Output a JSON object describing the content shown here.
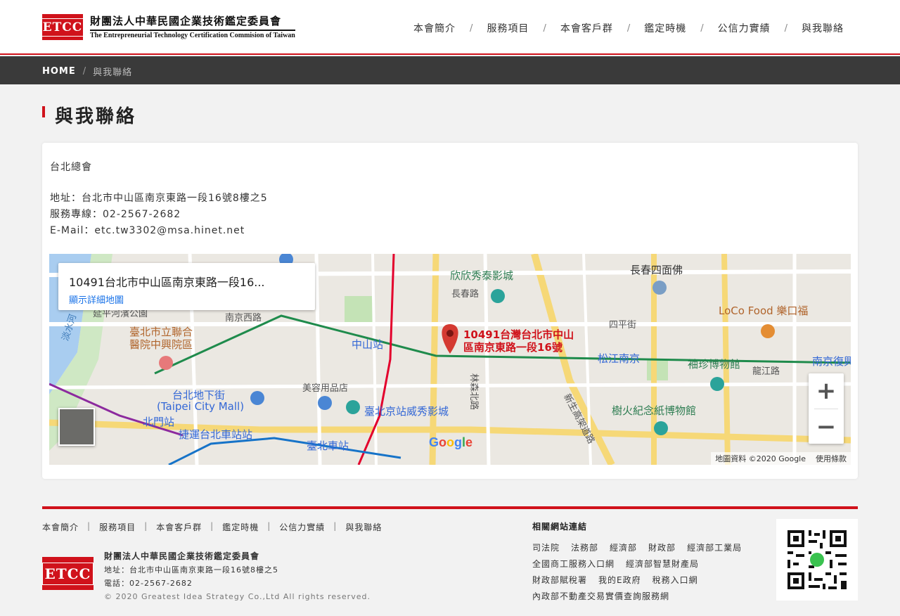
{
  "header": {
    "logo_badge": "ETCC",
    "logo_zh": "財團法人中華民國企業技術鑑定委員會",
    "logo_en": "The Entrepreneurial Technology Certification Commision of Taiwan",
    "nav": [
      "本會簡介",
      "服務項目",
      "本會客戶群",
      "鑑定時機",
      "公信力實績",
      "與我聯絡"
    ],
    "nav_sep": "/"
  },
  "breadcrumb": {
    "home": "HOME",
    "sep": "/",
    "current": "與我聯絡"
  },
  "page_title": "與我聯絡",
  "contact": {
    "office": "台北總會",
    "address": "地址：台北市中山區南京東路一段16號8樓之5",
    "phone": "服務專線：02-2567-2682",
    "email": "E-Mail：etc.tw3302@msa.hinet.net"
  },
  "map": {
    "info_address": "10491台北市中山區南京東路一段16...",
    "info_link": "顯示詳細地圖",
    "pin_label_1": "10491台灣台北市中山",
    "pin_label_2": "區南京東路一段16號",
    "zoom_in": "+",
    "zoom_out": "−",
    "attribution": "地圖資料 ©2020 Google",
    "terms": "使用條款",
    "labels": {
      "cinema": "欣欣秀泰影城",
      "changchun_rd": "長春路",
      "changchun_plaza": "長春四面佛",
      "loco": "LoCo Food 樂口福",
      "hospital_1": "臺北市立聯合",
      "hospital_2": "醫院中興院區",
      "zhongshan": "中山站",
      "songjiang": "松江南京",
      "xiuzhen": "袖珍博物館",
      "nanjing_w": "南京西路",
      "underground_1": "台北地下街",
      "underground_2": "(Taipei City Mall)",
      "beimen": "北門站",
      "main_station_mrt": "捷運台北車站站",
      "main_station_cinema": "臺北京站威秀影城",
      "beauty": "美容用品店",
      "taipei_station": "臺北車站",
      "paper_museum": "樹火紀念紙博物館",
      "danshui_river": "淡水河",
      "lane": "林森北路",
      "highway": "新生高架道路",
      "longjiang": "龍江路",
      "siping": "四平街",
      "park": "延平河濱公園",
      "nanjing_fu": "南京復興"
    }
  },
  "footer": {
    "nav": [
      "本會簡介",
      "服務項目",
      "本會客戶群",
      "鑑定時機",
      "公信力實績",
      "與我聯絡"
    ],
    "nav_sep": "|",
    "logo_badge": "ETCC",
    "org": "財團法人中華民國企業技術鑑定委員會",
    "address": "地址：台北市中山區南京東路一段16號8樓之5",
    "phone": "電話：02-2567-2682",
    "copyright": "© 2020 Greatest Idea Strategy Co.,Ltd All rights reserved.",
    "related_title": "相關網站連結",
    "links": [
      [
        "司法院",
        "法務部",
        "經濟部",
        "財政部",
        "經濟部工業局"
      ],
      [
        "全國商工服務入口網",
        "經濟部智慧財產局"
      ],
      [
        "財政部賦稅署",
        "我的E政府",
        "稅務入口網"
      ],
      [
        "內政部不動產交易實價查詢服務網"
      ]
    ]
  },
  "colors": {
    "brand_red": "#d0121b",
    "dark_bar": "#3a3a3a",
    "mrt_green": "#1f8b4c",
    "mrt_red": "#e3002c"
  }
}
